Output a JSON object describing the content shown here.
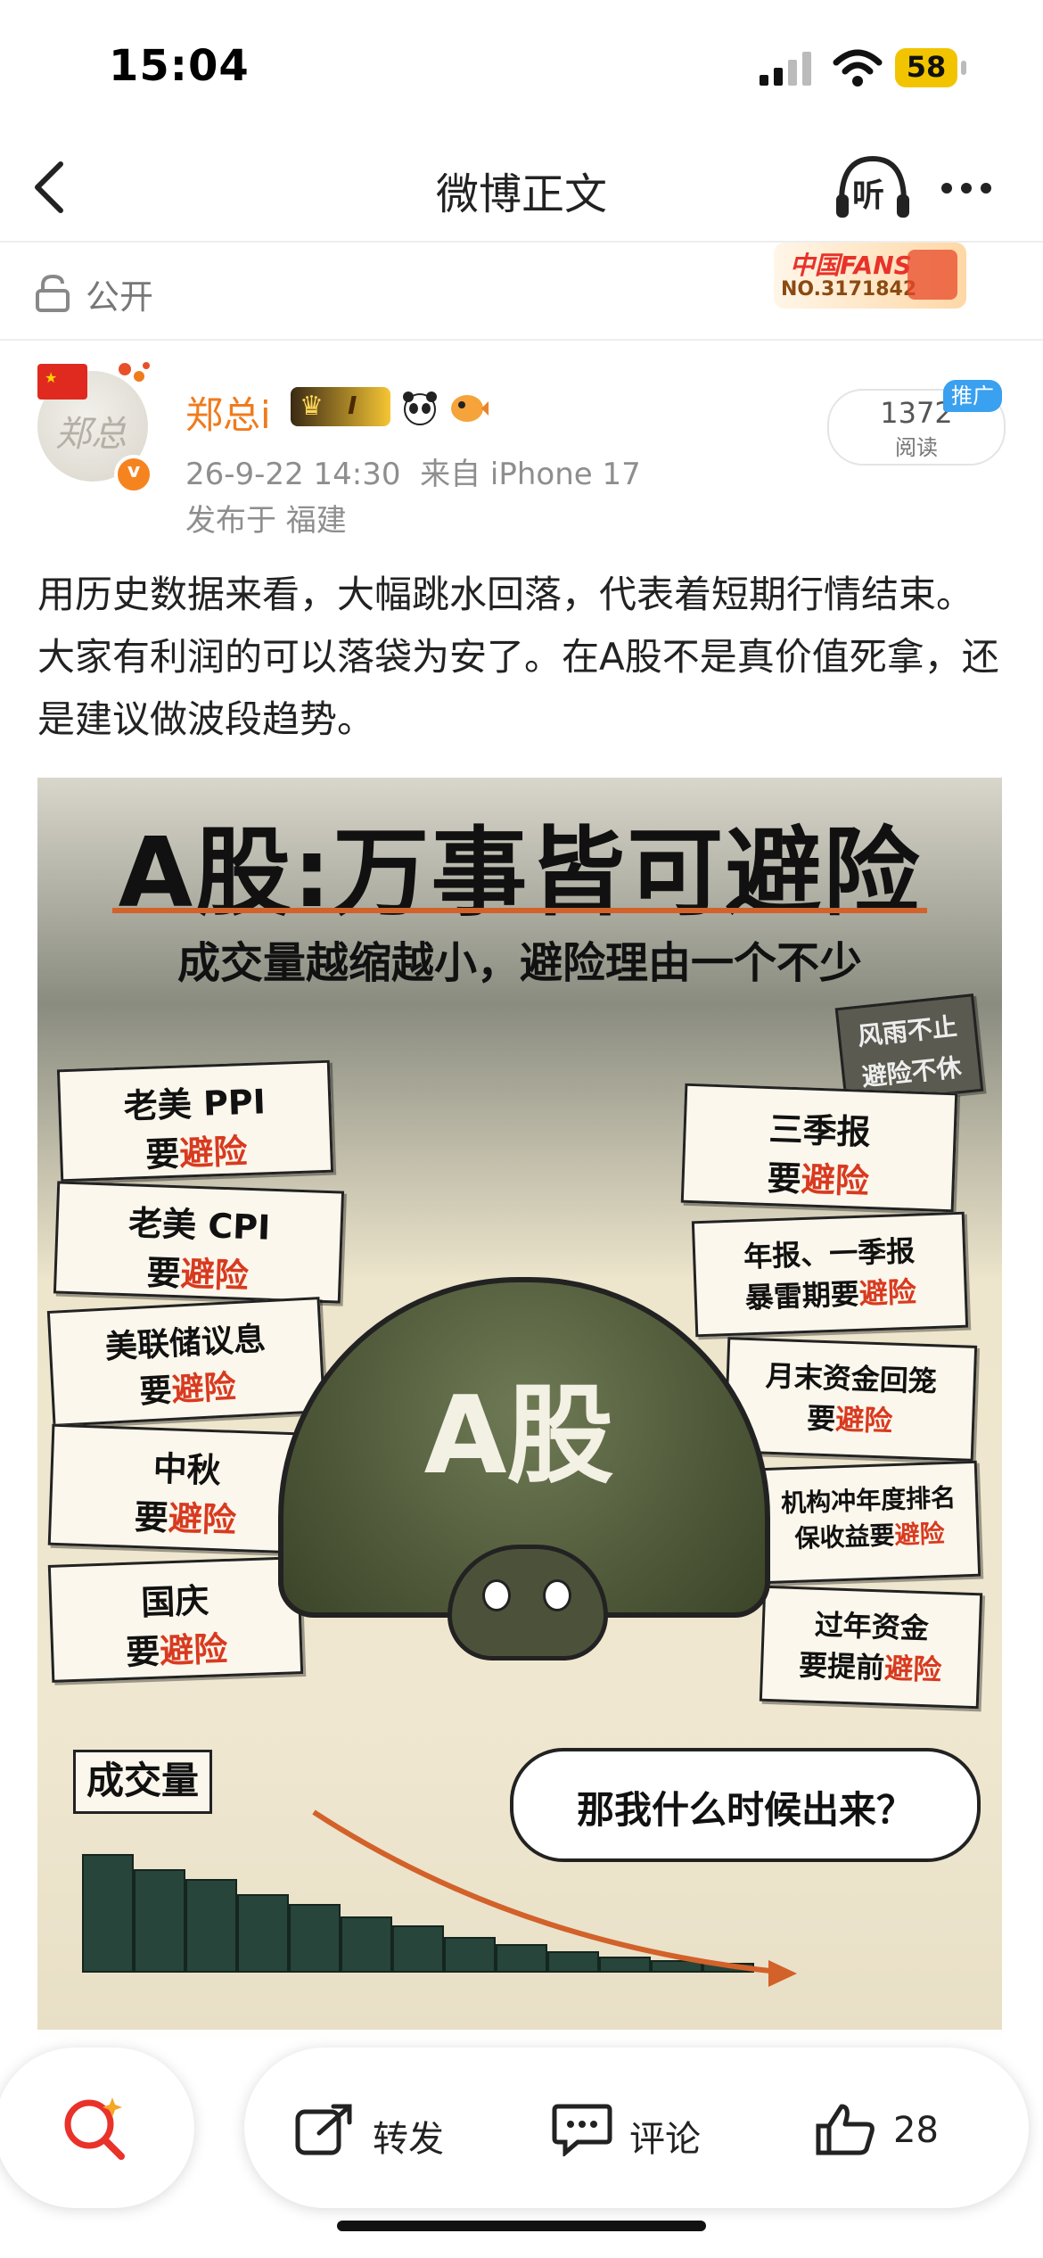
{
  "status_bar": {
    "time": "15:04",
    "battery": "58"
  },
  "nav": {
    "title": "微博正文",
    "listen_label": "听"
  },
  "visibility": {
    "label": "公开"
  },
  "fans_badge": {
    "brand": "中国FANS",
    "number": "NO.3171842"
  },
  "post": {
    "author": "郑总i",
    "avatar_text": "郑总",
    "vip_rank": "I",
    "timestamp": "26-9-22 14:30",
    "source": "来自 iPhone 17",
    "location": "发布于 福建",
    "read_count": "1372",
    "read_label": "阅读",
    "promo_tag": "推广",
    "text": "用历史数据来看，大幅跳水回落，代表着短期行情结束。大家有利润的可以落袋为安了。在A股不是真价值死拿，还是建议做波段趋势。"
  },
  "image": {
    "title": "A股:万事皆可避险",
    "subtitle": "成交量越缩越小，避险理由一个不少",
    "turtle_label": "A股",
    "bubble": "那我什么时候出来？",
    "volume_label": "成交量",
    "corner_sign_1": "风雨不止",
    "corner_sign_2": "避险不休",
    "reason_suffix": "避险",
    "left_notes": [
      {
        "line1": "老美 PPI",
        "line2": "要"
      },
      {
        "line1": "老美 CPI",
        "line2": "要"
      },
      {
        "line1": "美联储议息",
        "line2": "要"
      },
      {
        "line1": "中秋",
        "line2": "要"
      },
      {
        "line1": "国庆",
        "line2": "要"
      }
    ],
    "right_notes": [
      {
        "line1": "三季报",
        "line2": "要"
      },
      {
        "line1": "年报、一季报",
        "line2": "暴雷期要"
      },
      {
        "line1": "月末资金回笼",
        "line2": "要"
      },
      {
        "line1": "机构冲年度排名",
        "line2": "保收益要"
      },
      {
        "line1": "过年资金",
        "line2": "要提前"
      }
    ],
    "volume_bars": [
      0.92,
      0.8,
      0.72,
      0.6,
      0.52,
      0.42,
      0.35,
      0.26,
      0.2,
      0.14,
      0.1,
      0.07,
      0.05
    ]
  },
  "actions": {
    "repost": "转发",
    "comment": "评论",
    "like_count": "28"
  },
  "colors": {
    "accent_orange": "#f07b1d",
    "brand_red": "#d83a20",
    "promo_blue": "#3aa0f0"
  }
}
